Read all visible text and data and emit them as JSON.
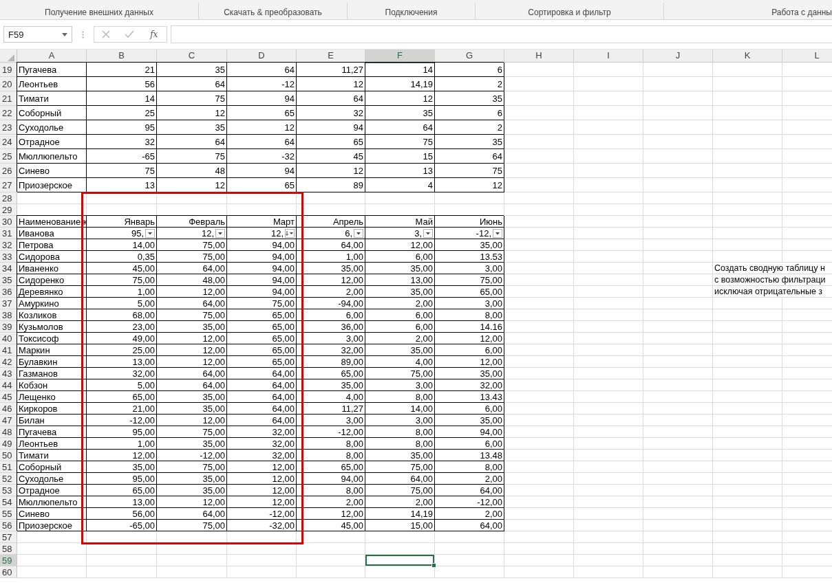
{
  "ribbon_groups": [
    "Получение внешних данных",
    "Скачать & преобразовать",
    "Подключения",
    "Сортировка и фильтр",
    "Работа с данны"
  ],
  "formula_bar": {
    "name_box": "F59",
    "function_label": "fx"
  },
  "columns": [
    {
      "label": "A",
      "selected": false
    },
    {
      "label": "B",
      "selected": false
    },
    {
      "label": "C",
      "selected": false
    },
    {
      "label": "D",
      "selected": false
    },
    {
      "label": "E",
      "selected": false
    },
    {
      "label": "F",
      "selected": true
    },
    {
      "label": "G",
      "selected": false
    },
    {
      "label": "H",
      "selected": false
    },
    {
      "label": "I",
      "selected": false
    },
    {
      "label": "J",
      "selected": false
    },
    {
      "label": "K",
      "selected": false
    },
    {
      "label": "L",
      "selected": false
    }
  ],
  "rows": [
    {
      "num": "19",
      "selected": false,
      "cells": [
        "Пугачева",
        "21",
        "35",
        "64",
        "11,27",
        "14",
        "6"
      ]
    },
    {
      "num": "20",
      "selected": false,
      "cells": [
        "Леонтьев",
        "56",
        "64",
        "-12",
        "12",
        "14,19",
        "2"
      ]
    },
    {
      "num": "21",
      "selected": false,
      "cells": [
        "Тимати",
        "14",
        "75",
        "94",
        "64",
        "12",
        "35"
      ]
    },
    {
      "num": "22",
      "selected": false,
      "cells": [
        "Соборный",
        "25",
        "12",
        "65",
        "32",
        "35",
        "6"
      ]
    },
    {
      "num": "23",
      "selected": false,
      "cells": [
        "Суходолье",
        "95",
        "35",
        "12",
        "94",
        "64",
        "2"
      ]
    },
    {
      "num": "24",
      "selected": false,
      "cells": [
        "Отрадное",
        "32",
        "64",
        "64",
        "65",
        "75",
        "35"
      ]
    },
    {
      "num": "25",
      "selected": false,
      "cells": [
        "Мюллюпельто",
        "-65",
        "75",
        "-32",
        "45",
        "15",
        "64"
      ]
    },
    {
      "num": "26",
      "selected": false,
      "cells": [
        "Синево",
        "75",
        "48",
        "94",
        "12",
        "13",
        "75"
      ]
    },
    {
      "num": "27",
      "selected": false,
      "cells": [
        "Приозерское",
        "13",
        "12",
        "65",
        "89",
        "4",
        "12"
      ]
    },
    {
      "num": "28",
      "selected": false
    },
    {
      "num": "29",
      "selected": false
    },
    {
      "num": "30",
      "selected": false,
      "cells": [
        "Наименование к",
        "Январь",
        "Февраль",
        "Март",
        "Апрель",
        "Май",
        "Июнь"
      ]
    },
    {
      "num": "31",
      "selected": false,
      "cells": [
        "Иванова",
        "95,",
        "12,",
        "12,",
        "6,",
        "3,",
        "-12,"
      ],
      "filters": [
        {
          "sorted": false
        },
        {
          "sorted": false
        },
        {
          "sorted": true
        },
        {
          "sorted": false
        },
        {
          "sorted": false
        },
        {
          "sorted": false
        }
      ]
    },
    {
      "num": "32",
      "selected": false,
      "cells": [
        "Петрова",
        "14,00",
        "75,00",
        "94,00",
        "64,00",
        "12,00",
        "35,00"
      ]
    },
    {
      "num": "33",
      "selected": false,
      "cells": [
        "Сидорова",
        "0,35",
        "75,00",
        "94,00",
        "1,00",
        "6,00",
        "13.53"
      ]
    },
    {
      "num": "34",
      "selected": false,
      "cells": [
        "Иваненко",
        "45,00",
        "64,00",
        "94,00",
        "35,00",
        "35,00",
        "3,00"
      ],
      "note": "Создать сводную таблицу н"
    },
    {
      "num": "35",
      "selected": false,
      "cells": [
        "Сидоренко",
        "75,00",
        "48,00",
        "94,00",
        "12,00",
        "13,00",
        "75,00"
      ],
      "note": "с возможностью фильтраци"
    },
    {
      "num": "36",
      "selected": false,
      "cells": [
        "Деревянко",
        "1,00",
        "12,00",
        "94,00",
        "2,00",
        "35,00",
        "65,00"
      ],
      "note": "исключая отрицательные з"
    },
    {
      "num": "37",
      "selected": false,
      "cells": [
        "Амуркино",
        "5,00",
        "64,00",
        "75,00",
        "-94,00",
        "2,00",
        "3,00"
      ]
    },
    {
      "num": "38",
      "selected": false,
      "cells": [
        "Козликов",
        "68,00",
        "75,00",
        "65,00",
        "6,00",
        "6,00",
        "8,00"
      ]
    },
    {
      "num": "39",
      "selected": false,
      "cells": [
        "Кузьмолов",
        "23,00",
        "35,00",
        "65,00",
        "36,00",
        "6,00",
        "14.16"
      ]
    },
    {
      "num": "40",
      "selected": false,
      "cells": [
        "Токсисоф",
        "49,00",
        "12,00",
        "65,00",
        "3,00",
        "2,00",
        "12,00"
      ]
    },
    {
      "num": "41",
      "selected": false,
      "cells": [
        "Маркин",
        "25,00",
        "12,00",
        "65,00",
        "32,00",
        "35,00",
        "6,00"
      ]
    },
    {
      "num": "42",
      "selected": false,
      "cells": [
        "Булавкин",
        "13,00",
        "12,00",
        "65,00",
        "89,00",
        "4,00",
        "12,00"
      ]
    },
    {
      "num": "43",
      "selected": false,
      "cells": [
        "Газманов",
        "32,00",
        "64,00",
        "64,00",
        "65,00",
        "75,00",
        "35,00"
      ]
    },
    {
      "num": "44",
      "selected": false,
      "cells": [
        "Кобзон",
        "5,00",
        "64,00",
        "64,00",
        "35,00",
        "3,00",
        "32,00"
      ]
    },
    {
      "num": "45",
      "selected": false,
      "cells": [
        "Лещенко",
        "65,00",
        "35,00",
        "64,00",
        "4,00",
        "8,00",
        "13.43"
      ]
    },
    {
      "num": "46",
      "selected": false,
      "cells": [
        "Киркоров",
        "21,00",
        "35,00",
        "64,00",
        "11,27",
        "14,00",
        "6,00"
      ]
    },
    {
      "num": "47",
      "selected": false,
      "cells": [
        "Билан",
        "-12,00",
        "12,00",
        "64,00",
        "3,00",
        "3,00",
        "35,00"
      ]
    },
    {
      "num": "48",
      "selected": false,
      "cells": [
        "Пугачева",
        "95,00",
        "75,00",
        "32,00",
        "-12,00",
        "8,00",
        "94,00"
      ]
    },
    {
      "num": "49",
      "selected": false,
      "cells": [
        "Леонтьев",
        "1,00",
        "35,00",
        "32,00",
        "8,00",
        "8,00",
        "6,00"
      ]
    },
    {
      "num": "50",
      "selected": false,
      "cells": [
        "Тимати",
        "12,00",
        "-12,00",
        "32,00",
        "8,00",
        "35,00",
        "13.48"
      ]
    },
    {
      "num": "51",
      "selected": false,
      "cells": [
        "Соборный",
        "35,00",
        "75,00",
        "12,00",
        "65,00",
        "75,00",
        "8,00"
      ]
    },
    {
      "num": "52",
      "selected": false,
      "cells": [
        "Суходолье",
        "95,00",
        "35,00",
        "12,00",
        "94,00",
        "64,00",
        "2,00"
      ]
    },
    {
      "num": "53",
      "selected": false,
      "cells": [
        "Отрадное",
        "65,00",
        "35,00",
        "12,00",
        "8,00",
        "75,00",
        "64,00"
      ]
    },
    {
      "num": "54",
      "selected": false,
      "cells": [
        "Мюллюпельто",
        "13,00",
        "12,00",
        "12,00",
        "2,00",
        "2,00",
        "-12,00"
      ]
    },
    {
      "num": "55",
      "selected": false,
      "cells": [
        "Синево",
        "56,00",
        "64,00",
        "-12,00",
        "12,00",
        "14,19",
        "2,00"
      ]
    },
    {
      "num": "56",
      "selected": false,
      "cells": [
        "Приозерское",
        "-65,00",
        "75,00",
        "-32,00",
        "45,00",
        "15,00",
        "64,00"
      ]
    },
    {
      "num": "57",
      "selected": false
    },
    {
      "num": "58",
      "selected": false
    },
    {
      "num": "59",
      "selected": true
    },
    {
      "num": "60",
      "selected": false
    }
  ]
}
